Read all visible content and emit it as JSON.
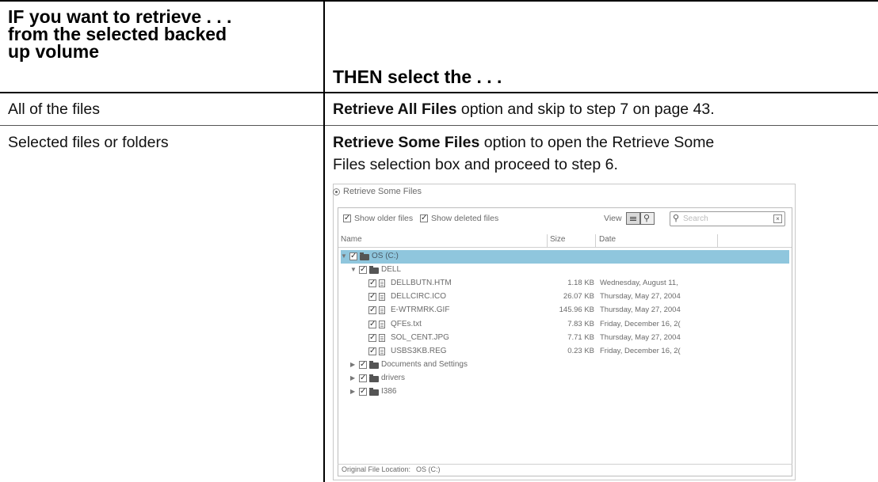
{
  "table": {
    "col1_header": [
      "IF you want to retrieve . . .",
      "from the selected backed",
      "up volume"
    ],
    "col2_header": "THEN select the . . .",
    "rows": [
      {
        "condition": "All of the files",
        "action_bold": "Retrieve All Files",
        "action_rest": " option and skip to step 7 on page 43."
      },
      {
        "condition": "Selected files or folders",
        "action_bold": "Retrieve Some Files",
        "action_rest_line1": " option to open the Retrieve Some",
        "action_rest_line2": "Files selection box and proceed to step 6."
      }
    ]
  },
  "dialog": {
    "title": "Retrieve Some Files",
    "show_older_label": "Show older files",
    "show_deleted_label": "Show deleted files",
    "view_label": "View",
    "search_placeholder": "Search",
    "columns": {
      "name": "Name",
      "size": "Size",
      "date": "Date"
    },
    "tree": [
      {
        "name": "OS (C:)",
        "size": "",
        "date": "",
        "level": 0,
        "type": "drive",
        "expanded": true,
        "selected": true
      },
      {
        "name": "DELL",
        "size": "",
        "date": "",
        "level": 1,
        "type": "folder",
        "expanded": true
      },
      {
        "name": "DELLBUTN.HTM",
        "size": "1.18 KB",
        "date": "Wednesday, August 11,",
        "level": 2,
        "type": "file"
      },
      {
        "name": "DELLCIRC.ICO",
        "size": "26.07 KB",
        "date": "Thursday, May 27, 2004",
        "level": 2,
        "type": "file"
      },
      {
        "name": "E-WTRMRK.GIF",
        "size": "145.96 KB",
        "date": "Thursday, May 27, 2004",
        "level": 2,
        "type": "file"
      },
      {
        "name": "QFEs.txt",
        "size": "7.83 KB",
        "date": "Friday, December 16, 2(",
        "level": 2,
        "type": "file"
      },
      {
        "name": "SOL_CENT.JPG",
        "size": "7.71 KB",
        "date": "Thursday, May 27, 2004",
        "level": 2,
        "type": "file"
      },
      {
        "name": "USBS3KB.REG",
        "size": "0.23 KB",
        "date": "Friday, December 16, 2(",
        "level": 2,
        "type": "file"
      },
      {
        "name": "Documents and Settings",
        "size": "",
        "date": "",
        "level": 1,
        "type": "folder",
        "expanded": false
      },
      {
        "name": "drivers",
        "size": "",
        "date": "",
        "level": 1,
        "type": "folder",
        "expanded": false
      },
      {
        "name": "I386",
        "size": "",
        "date": "",
        "level": 1,
        "type": "folder",
        "expanded": false
      }
    ],
    "status_label": "Original File Location:",
    "status_value": "OS (C:)"
  }
}
